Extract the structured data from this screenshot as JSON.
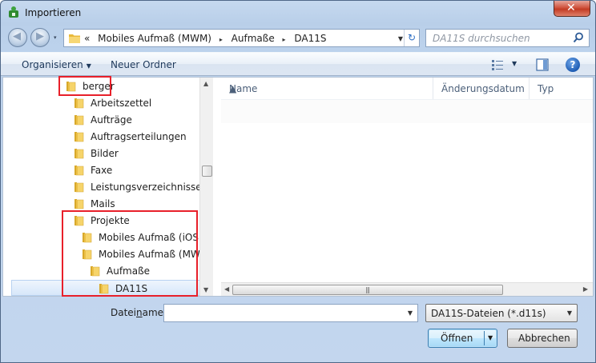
{
  "window": {
    "title": "Importieren",
    "close_glyph": "✕"
  },
  "nav": {
    "back_glyph": "◀",
    "forward_glyph": "▶",
    "recent_glyph": "▾",
    "address": {
      "overflow": "«",
      "crumbs": [
        "Mobiles Aufmaß (MWM)",
        "Aufmaße",
        "DA11S"
      ],
      "separator": "▸",
      "dropdown_glyph": "▼"
    },
    "refresh_glyph": "↻",
    "search": {
      "placeholder": "DA11S durchsuchen"
    }
  },
  "toolbar": {
    "organize_label": "Organisieren",
    "organize_caret": "▼",
    "new_folder_label": "Neuer Ordner",
    "help_label": "?",
    "view_caret": "▼"
  },
  "tree": {
    "items": [
      {
        "label": "berger",
        "level": 0
      },
      {
        "label": "Arbeitszettel",
        "level": 1
      },
      {
        "label": "Aufträge",
        "level": 1
      },
      {
        "label": "Auftragserteilungen",
        "level": 1
      },
      {
        "label": "Bilder",
        "level": 1
      },
      {
        "label": "Faxe",
        "level": 1
      },
      {
        "label": "Leistungsverzeichnisse",
        "level": 1
      },
      {
        "label": "Mails",
        "level": 1
      },
      {
        "label": "Projekte",
        "level": 1
      },
      {
        "label": "Mobiles Aufmaß (iOS)",
        "level": 2
      },
      {
        "label": "Mobiles Aufmaß (MWM)",
        "level": 2
      },
      {
        "label": "Aufmaße",
        "level": 3
      },
      {
        "label": "DA11S",
        "level": 4,
        "selected": true
      }
    ],
    "scroll_up": "▲",
    "scroll_down": "▼"
  },
  "file_list": {
    "columns": [
      "Name",
      "Änderungsdatum",
      "Typ"
    ],
    "sort_glyph": "▲",
    "scroll_left": "◀",
    "scroll_right": "▶",
    "grip": "|||"
  },
  "footer": {
    "filename_label_pre": "Datei",
    "filename_label_underlined": "n",
    "filename_label_post": "ame:",
    "filename_value": "",
    "filename_dropdown": "▼",
    "filetype_value": "DA11S-Dateien (*.d11s)",
    "filetype_dropdown": "▼",
    "open_label": "Öffnen",
    "open_dropdown": "▼",
    "cancel_label": "Abbrechen"
  },
  "colors": {
    "highlight_box": "#e8202a",
    "folder_yellow": "#f1c94b"
  }
}
